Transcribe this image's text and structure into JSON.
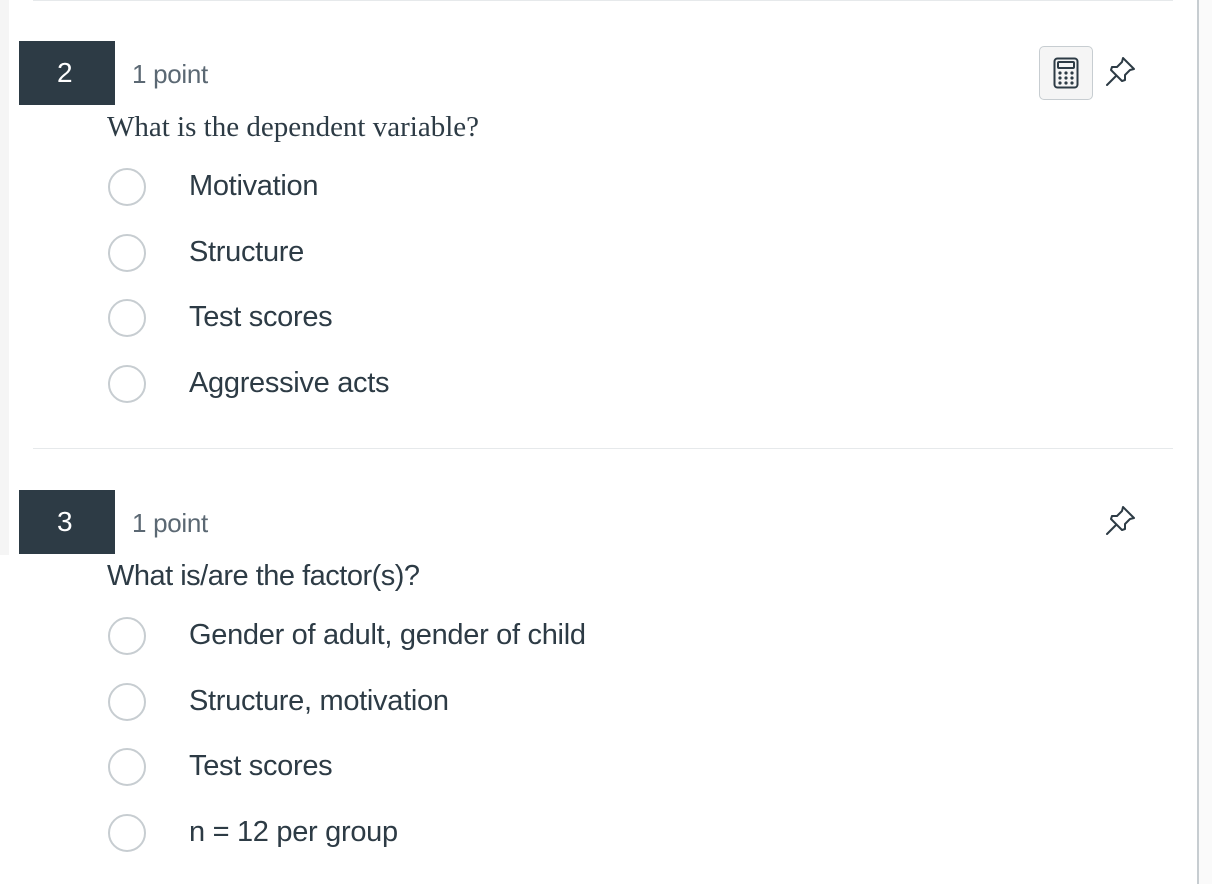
{
  "questions": [
    {
      "number": "2",
      "points": "1 point",
      "text": "What is the dependent variable?",
      "has_calculator": true,
      "icons": {
        "calculator": "calculator-icon",
        "pin": "pin-icon"
      },
      "answers": [
        "Motivation",
        "Structure",
        "Test scores",
        "Aggressive acts"
      ]
    },
    {
      "number": "3",
      "points": "1 point",
      "text": "What is/are the factor(s)?",
      "has_calculator": false,
      "icons": {
        "pin": "pin-icon"
      },
      "answers": [
        "Gender of adult, gender of child",
        "Structure, motivation",
        "Test scores",
        "n = 12 per group"
      ]
    }
  ],
  "colors": {
    "number_badge_bg": "#2d3b45",
    "text": "#2d3b45",
    "muted_text": "#5b6873",
    "radio_border": "#c7cdd1"
  }
}
